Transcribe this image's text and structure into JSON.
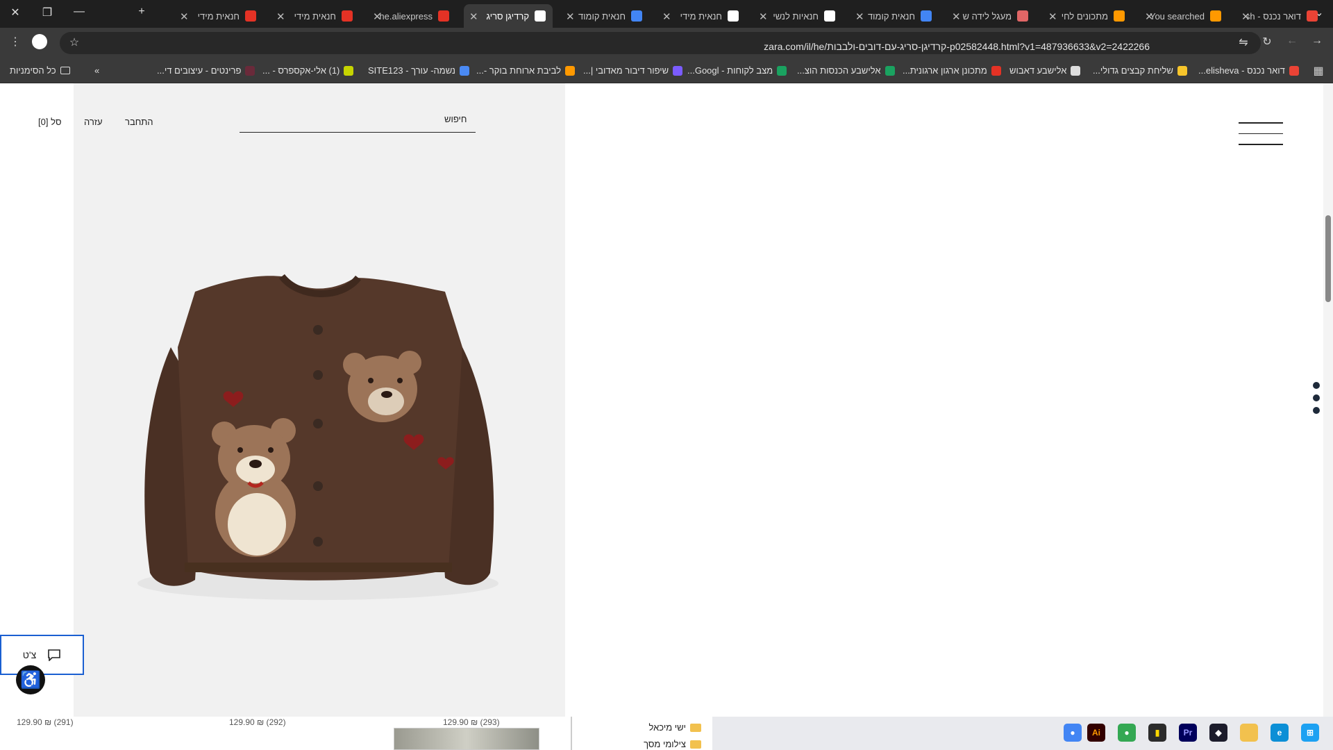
{
  "browser": {
    "tabs": [
      {
        "title": "דואר נכנס - elish",
        "icon": "gmail-icon",
        "color": "#ea4335"
      },
      {
        "title": "You searched",
        "icon": "amazon-icon",
        "color": "#ff9900"
      },
      {
        "title": "מתכונים לחי",
        "icon": "amazon-icon",
        "color": "#ff9900"
      },
      {
        "title": "מעגל לידה ש",
        "icon": "circle-logo-icon",
        "color": "#e06666"
      },
      {
        "title": "חנאית קומוד",
        "icon": "google-icon",
        "color": "#4285f4"
      },
      {
        "title": "חנאיות לנשי",
        "icon": "zara-icon",
        "color": "#ffffff"
      },
      {
        "title": "חנאית מידי",
        "icon": "zara-icon",
        "color": "#ffffff"
      },
      {
        "title": "חנאית קומוד",
        "icon": "google-icon",
        "color": "#4285f4"
      },
      {
        "title": "קרדיגן סריג",
        "icon": "zara-icon",
        "color": "#ffffff",
        "active": true
      },
      {
        "title": "he.aliexpress",
        "icon": "aliexpress-icon",
        "color": "#e43225"
      },
      {
        "title": "חנאית מידי",
        "icon": "aliexpress-icon",
        "color": "#e43225"
      },
      {
        "title": "חנאית מידי",
        "icon": "aliexpress-icon",
        "color": "#e43225"
      }
    ],
    "url": "zara.com/il/he/קרדיגן-סריג-עם-דובים-ולבבות-p02582448.html?v1=487936633&v2=2422266",
    "bookmarks": [
      {
        "label": "דואר נכנס - elisheva...",
        "color": "#ea4335"
      },
      {
        "label": "שליחת קבצים גדולי...",
        "color": "#f7c52b"
      },
      {
        "label": "אלישבע דאבוש",
        "color": "#dddddd"
      },
      {
        "label": "מתכונן ארגון ארגונית...",
        "color": "#e43225"
      },
      {
        "label": "אלישבע הכנסות הוצ...",
        "color": "#1aa260"
      },
      {
        "label": "מצב לקוחות - Googl...",
        "color": "#1aa260"
      },
      {
        "label": "שיפור דיבור מאדובי |...",
        "color": "#7b5cff"
      },
      {
        "label": "לביבת ארוחת בוקר -...",
        "color": "#ff9900"
      },
      {
        "label": "נשמה- עורך - SITE123",
        "color": "#4a8af4"
      },
      {
        "label": "(1) אלי-אקספרס - ...",
        "color": "#c6d400"
      },
      {
        "label": "פרינטים - עיצובים די...",
        "color": "#6a2a3a"
      }
    ],
    "all_bookmarks_label": "כל הסימניות"
  },
  "site": {
    "search_label": "חיפוש",
    "login_label": "התחבר",
    "help_label": "עזרה",
    "cart_label": "סל [0]",
    "chat_label": "צ'ט",
    "product_image_alt": "קרדיגן סריג עם דובים ולבבות"
  },
  "bottom": {
    "prices": [
      "(293) ₪ 129.90",
      "(292) ₪ 129.90",
      "(291) ₪ 129.90"
    ],
    "folders": [
      "ישי מיכאל",
      "צילומי מסך"
    ]
  }
}
